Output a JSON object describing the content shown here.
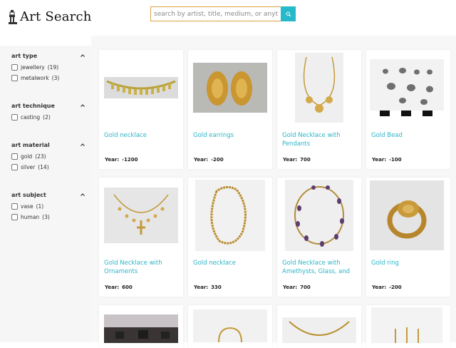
{
  "app": {
    "title": "Art Search"
  },
  "search": {
    "placeholder": "search by artist, title, medium, or anyth",
    "value": ""
  },
  "sidebar": {
    "facets": [
      {
        "title": "art type",
        "options": [
          {
            "label": "jewellery",
            "count": "(19)"
          },
          {
            "label": "metalwork",
            "count": "(3)"
          }
        ]
      },
      {
        "title": "art technique",
        "options": [
          {
            "label": "casting",
            "count": "(2)"
          }
        ]
      },
      {
        "title": "art material",
        "options": [
          {
            "label": "gold",
            "count": "(23)"
          },
          {
            "label": "silver",
            "count": "(14)"
          }
        ]
      },
      {
        "title": "art subject",
        "options": [
          {
            "label": "vase",
            "count": "(1)"
          },
          {
            "label": "human",
            "count": "(3)"
          }
        ]
      }
    ]
  },
  "results": {
    "year_label": "Year:",
    "cards": [
      {
        "title": "Gold necklace",
        "year": "-1200",
        "image": "gold-collar-necklace"
      },
      {
        "title": "Gold earrings",
        "year": "-200",
        "image": "gold-earrings"
      },
      {
        "title": "Gold Necklace with Pendants",
        "year": "700",
        "image": "gold-pendant-necklace"
      },
      {
        "title": "Gold Bead",
        "year": "-100",
        "image": "gold-beads"
      },
      {
        "title": "Gold Necklace with Ornaments",
        "year": "600",
        "image": "gold-ornament-necklace"
      },
      {
        "title": "Gold necklace",
        "year": "330",
        "image": "gold-bead-necklace"
      },
      {
        "title": "Gold Necklace with Amethysts, Glass, and",
        "year": "700",
        "image": "amethyst-necklace"
      },
      {
        "title": "Gold ring",
        "year": "-200",
        "image": "gold-ring"
      },
      {
        "title": "",
        "year": "",
        "image": "dark-bracelet"
      },
      {
        "title": "",
        "year": "",
        "image": "gold-torc"
      },
      {
        "title": "",
        "year": "",
        "image": "gold-hoop"
      },
      {
        "title": "",
        "year": "",
        "image": "gold-earring-pendants"
      }
    ]
  },
  "colors": {
    "accent": "#26b9c9",
    "link": "#2bb5c8",
    "search_border": "#d9a441"
  }
}
